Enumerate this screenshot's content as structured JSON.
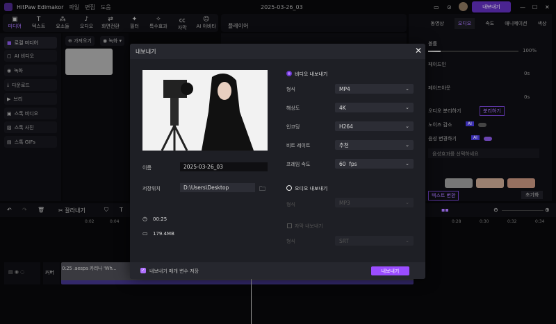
{
  "app": {
    "name": "HitPaw Edimakor",
    "menu": [
      "파일",
      "편집",
      "도움"
    ],
    "project_title": "2025-03-26_03",
    "export_label": "내보내기"
  },
  "toolbar": [
    {
      "icon": "media-icon",
      "label": "미디어"
    },
    {
      "icon": "text-icon",
      "label": "텍스트"
    },
    {
      "icon": "elements-icon",
      "label": "요소들"
    },
    {
      "icon": "audio-icon",
      "label": "오디오"
    },
    {
      "icon": "transition-icon",
      "label": "화면전환"
    },
    {
      "icon": "filter-icon",
      "label": "필터"
    },
    {
      "icon": "effects-icon",
      "label": "특수효과"
    },
    {
      "icon": "subtitle-icon",
      "label": "자막"
    },
    {
      "icon": "ai-avatar-icon",
      "label": "AI 아바타"
    }
  ],
  "player_label": "플레이어",
  "sidebar": [
    "로컬 미디어",
    "AI 비디오",
    "녹화",
    "다운로드",
    "브리",
    "스톡 비디오",
    "스톡 사진",
    "스톡 GIFs"
  ],
  "media_toolbar": {
    "import": "가져오기",
    "record": "녹화"
  },
  "right_panel": {
    "tabs": [
      "동영상",
      "오디오",
      "속도",
      "애니메이션",
      "색상"
    ],
    "active_tab": "오디오",
    "volume_label": "볼륨",
    "volume_value": "100%",
    "fade_in_label": "페이드인",
    "fade_in_value": "0s",
    "fade_out_label": "페이드아웃",
    "fade_out_value": "0s",
    "separate_label": "오디오 분리하기",
    "separate_button": "분리하기",
    "denoise_label": "노이즈 감소",
    "ai_badge": "AI",
    "voice_change_label": "음성 변경하기",
    "voice_select_placeholder": "음성효과를 선택하세요",
    "text_to_speech_button": "텍스트 변환",
    "reset_button": "초기화"
  },
  "timeline": {
    "cut_label": "잘라내기",
    "track_label": "커버",
    "clip_label": "0:25 .aespa 카리나 'Wh...",
    "ruler": [
      "0:02",
      "0:04",
      "0:28",
      "0:30",
      "0:32",
      "0:34"
    ]
  },
  "dialog": {
    "title": "내보내기",
    "name_label": "이름",
    "name_value": "2025-03-26_03",
    "location_label": "저장위치",
    "location_value": "D:\\Users\\Desktop",
    "duration": "00:25",
    "size": "179.4MB",
    "video_export_label": "비디오 내보내기",
    "format_label": "형식",
    "format_value": "MP4",
    "resolution_label": "해상도",
    "resolution_value": "4K",
    "encoder_label": "인코딩",
    "encoder_value": "H264",
    "bitrate_label": "비트 레이트",
    "bitrate_value": "추천",
    "framerate_label": "프레임 속도",
    "framerate_value": "60  fps",
    "audio_export_label": "오디오 내보내기",
    "audio_format_label": "형식",
    "audio_format_value": "MP3",
    "subtitle_export_label": "자막 내보내기",
    "subtitle_format_label": "형식",
    "subtitle_format_value": "SRT",
    "save_params_label": "내보내기 매개 변수 저장",
    "save_params_checked": true,
    "export_button": "내보내기",
    "video_export_selected": true
  },
  "colors": {
    "accent": "#9b4dff",
    "bg": "#0a0a0d",
    "dialog": "#1e1f25"
  }
}
